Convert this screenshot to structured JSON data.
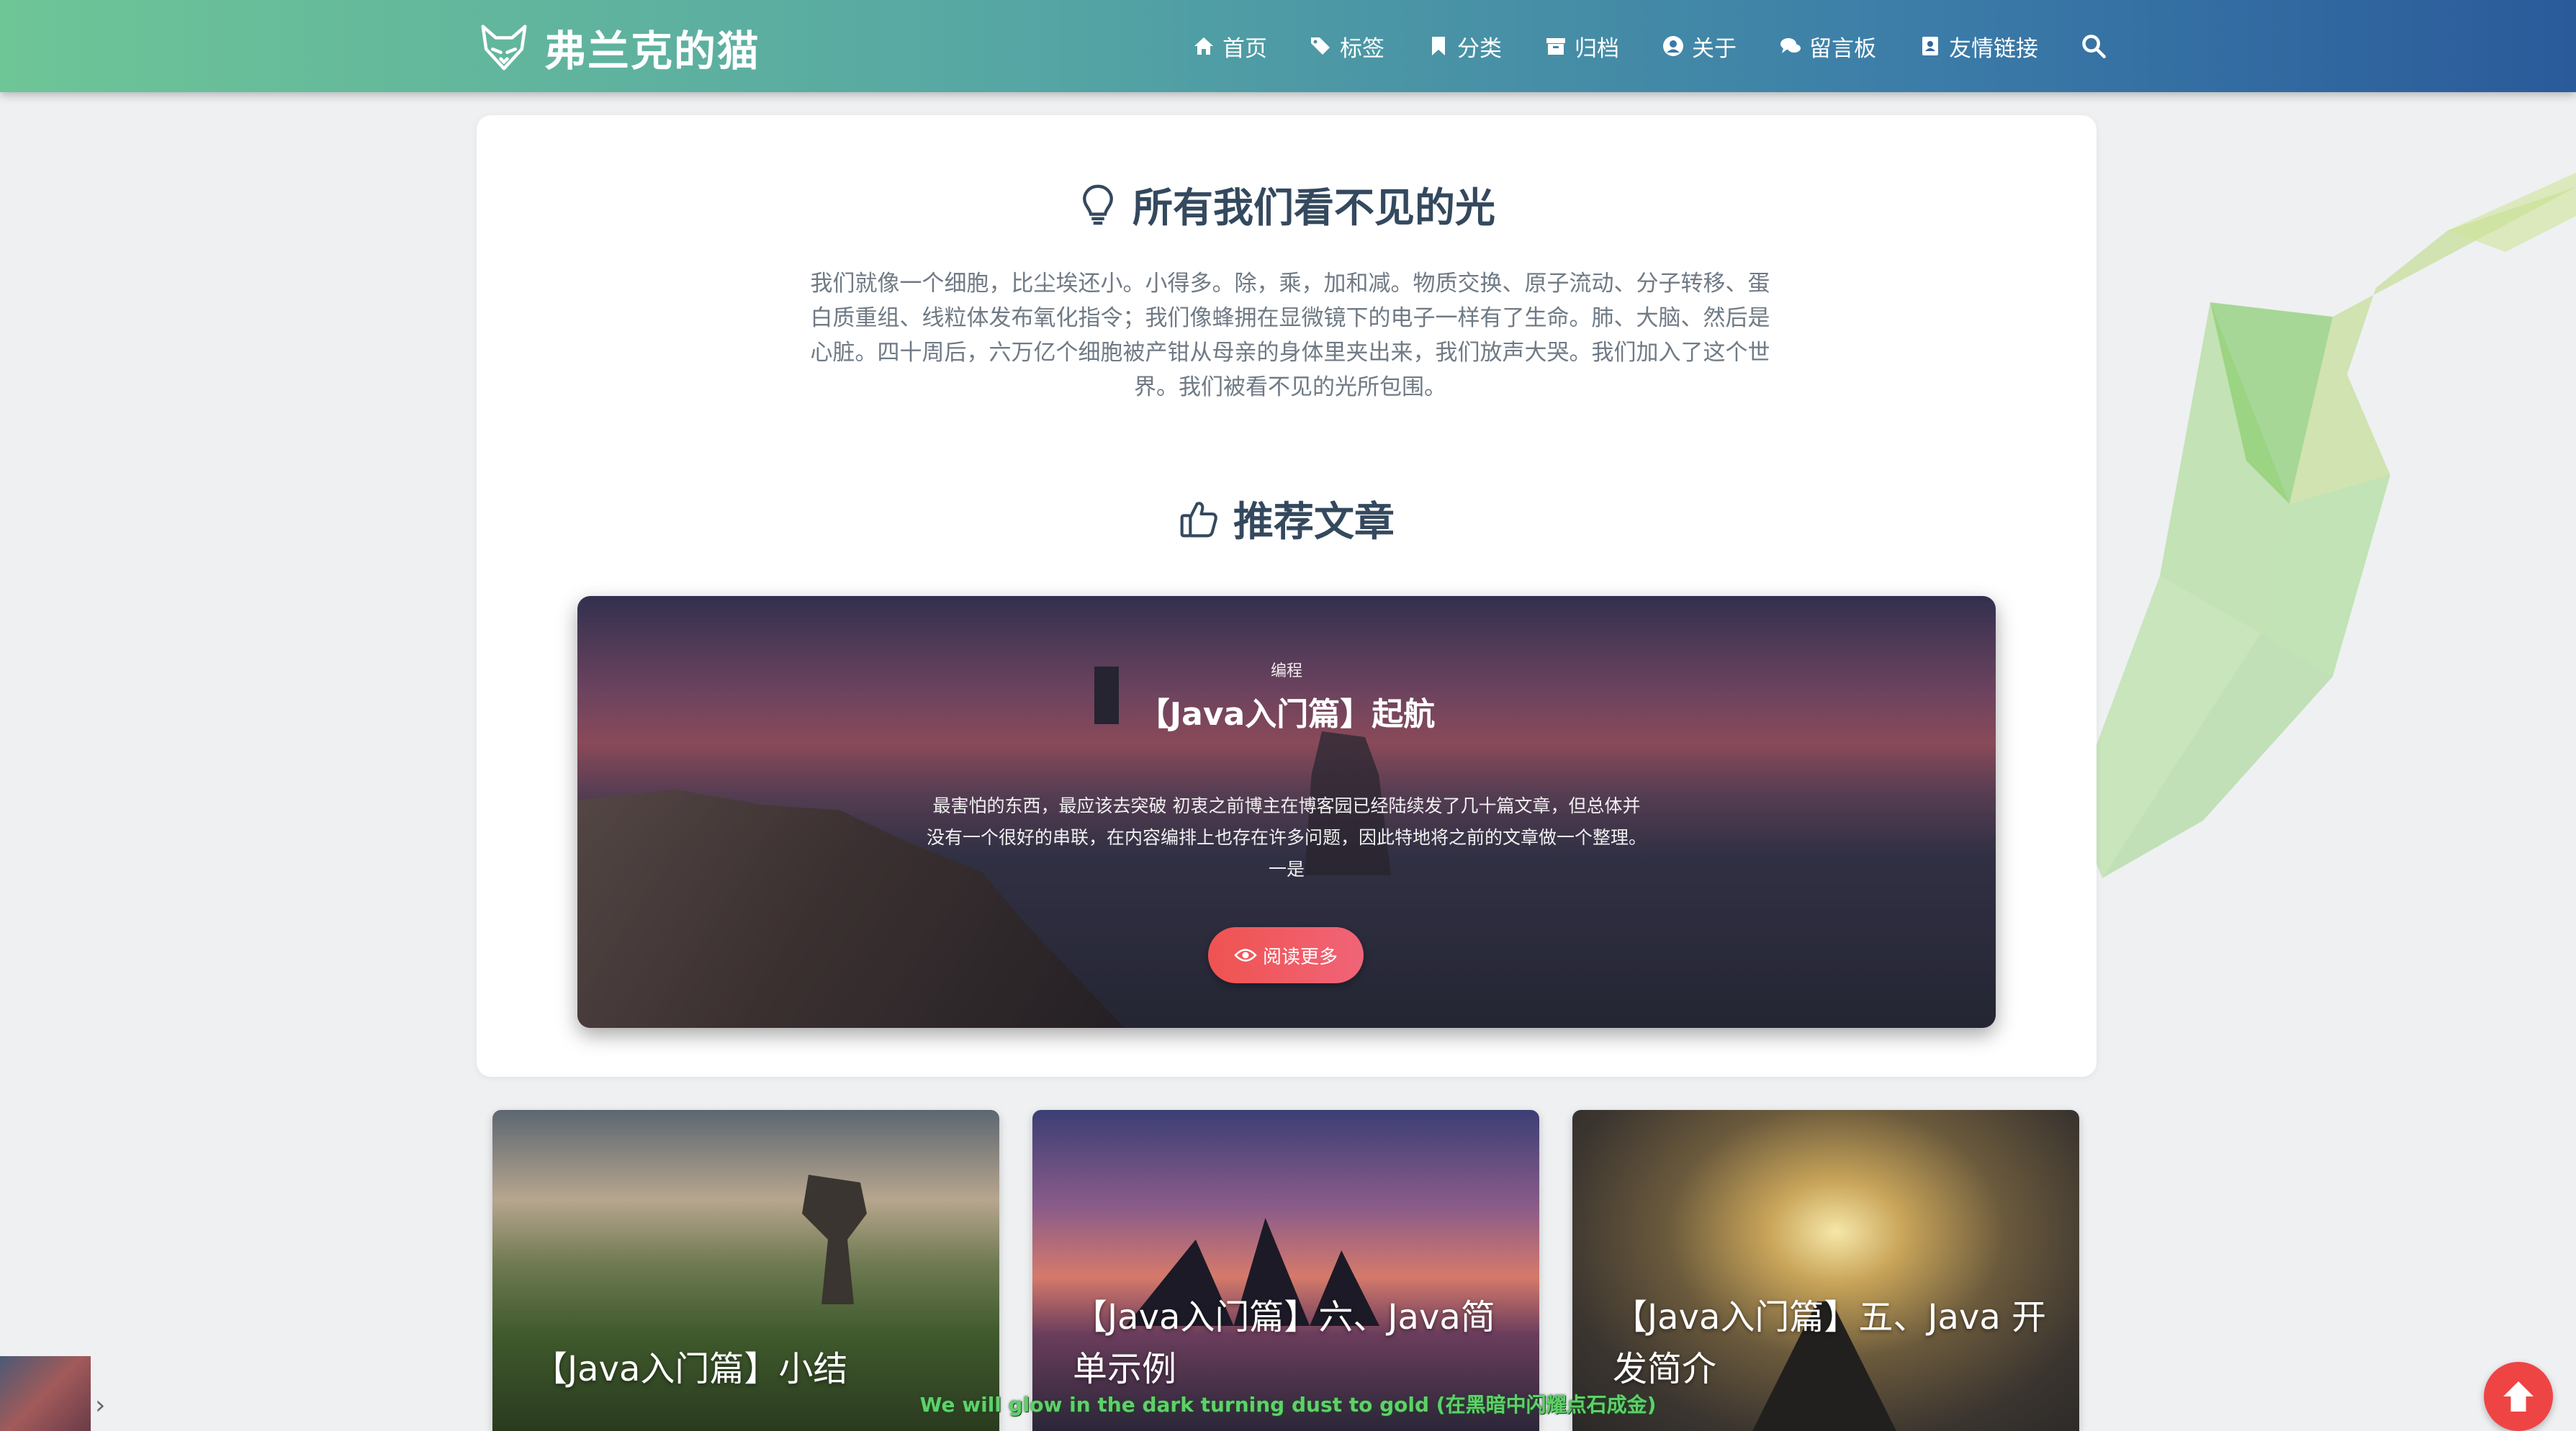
{
  "site": {
    "logo_text": "弗兰克的猫"
  },
  "nav": {
    "items": [
      {
        "label": "首页",
        "icon": "home-icon"
      },
      {
        "label": "标签",
        "icon": "tags-icon"
      },
      {
        "label": "分类",
        "icon": "bookmark-icon"
      },
      {
        "label": "归档",
        "icon": "archive-icon"
      },
      {
        "label": "关于",
        "icon": "user-circle-icon"
      },
      {
        "label": "留言板",
        "icon": "comments-icon"
      },
      {
        "label": "友情链接",
        "icon": "address-book-icon"
      }
    ],
    "search_icon": "search-icon"
  },
  "intro": {
    "title": "所有我们看不见的光",
    "text": "我们就像一个细胞，比尘埃还小。小得多。除，乘，加和减。物质交换、原子流动、分子转移、蛋白质重组、线粒体发布氧化指令；我们像蜂拥在显微镜下的电子一样有了生命。肺、大脑、然后是心脏。四十周后，六万亿个细胞被产钳从母亲的身体里夹出来，我们放声大哭。我们加入了这个世界。我们被看不见的光所包围。"
  },
  "recommend": {
    "title": "推荐文章"
  },
  "featured": {
    "category": "编程",
    "title": "【Java入门篇】起航",
    "excerpt": "最害怕的东西，最应该去突破 初衷之前博主在博客园已经陆续发了几十篇文章，但总体并没有一个很好的串联，在内容编排上也存在许多问题，因此特地将之前的文章做一个整理。一是",
    "button": "阅读更多"
  },
  "posts": [
    {
      "title": "【Java入门篇】小结"
    },
    {
      "title": "【Java入门篇】六、Java简单示例"
    },
    {
      "title": "【Java入门篇】五、Java 开发简介"
    }
  ],
  "player": {
    "subtitle": "We will glow in the dark turning dust to gold (在黑暗中闪耀点石成金)"
  },
  "colors": {
    "accent": "#ef4444",
    "header_start": "#6ec596",
    "header_end": "#2a5a9a",
    "subtitle": "#5fd06a"
  }
}
